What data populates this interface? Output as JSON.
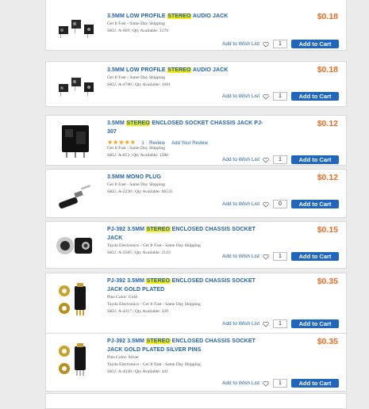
{
  "common": {
    "wish_label": "Add to Wish List",
    "cart_label": "Add to Cart"
  },
  "products": [
    {
      "title_pre": "3.5MM LOW PROFILE ",
      "title_hl": "STEREO",
      "title_post": " AUDIO JACK",
      "lines": [
        "Get It Fast - Same Day Shipping",
        "SKU: A-069 | Qty Available: 3170"
      ],
      "price": "$0.18",
      "qty": "1"
    },
    {
      "title_pre": "3.5MM LOW PROFILE ",
      "title_hl": "STEREO",
      "title_post": " AUDIO JACK",
      "lines": [
        "Get It Fast - Same Day Shipping",
        "SKU: A-4780 | Qty Available: 1681"
      ],
      "price": "$0.18",
      "qty": "1"
    },
    {
      "title_pre": "3.5MM ",
      "title_hl": "STEREO",
      "title_post": " ENCLOSED SOCKET CHASSIS JACK PJ-307",
      "rating": {
        "stars": "★★★★★",
        "count": "1",
        "review_label": "Review",
        "add_review": "Add Your Review"
      },
      "lines": [
        "Get It Fast - Same Day Shipping",
        "SKU: A-853 | Qty Available: 1580"
      ],
      "price": "$0.12",
      "qty": "1"
    },
    {
      "title_pre": "3.5MM MONO PLUG",
      "title_hl": "",
      "title_post": "",
      "lines": [
        "Get It Fast - Same Day Shipping",
        "SKU: A-2238 | Qty Available: 66535"
      ],
      "price": "$0.12",
      "qty": "0"
    },
    {
      "title_pre": "PJ-392 3.5MM ",
      "title_hl": "STEREO",
      "title_post": " ENCLOSED CHASSIS SOCKET JACK",
      "lines": [
        "Tayda Electronics - Get It Fast - Same Day Shipping",
        "SKU: A-2585 | Qty Available: 2123"
      ],
      "price": "$0.15",
      "qty": "1"
    },
    {
      "title_pre": "PJ-392 3.5MM ",
      "title_hl": "STEREO",
      "title_post": " ENCLOSED CHASSIS SOCKET JACK GOLD PLATED",
      "lines": [
        "Pins Color: Gold",
        "Tayda Electronics - Get It Fast - Same Day Shipping",
        "SKU: A-4317 | Qty Available: 320"
      ],
      "price": "$0.35",
      "qty": "1"
    },
    {
      "title_pre": "PJ-392 3.5MM ",
      "title_hl": "STEREO",
      "title_post": " ENCLOSED CHASSIS SOCKET JACK GOLD PLATED SILVER PINS",
      "lines": [
        "Pins Color: Silver",
        "Tayda Electronics - Get It Fast - Same Day Shipping",
        "SKU: A-4338 | Qty Available: 441"
      ],
      "price": "$0.35",
      "qty": "1"
    }
  ],
  "colors": {
    "link": "#1f61a8",
    "price": "#f06a1d",
    "highlight": "#f7ec12",
    "button": "#1f66c1"
  }
}
